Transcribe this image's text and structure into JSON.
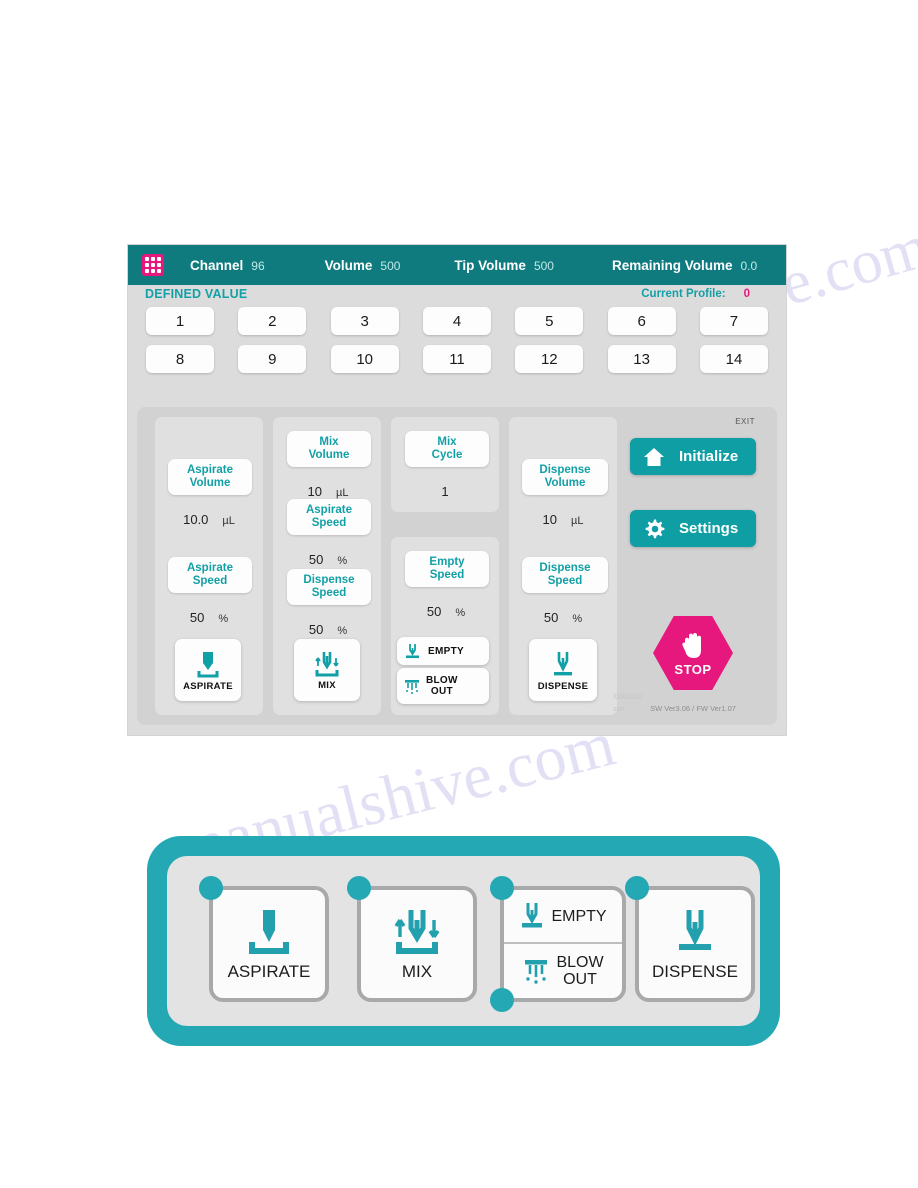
{
  "watermark": {
    "line_a": "manualshive.com",
    "line_b": "manualshive.com"
  },
  "device": {
    "header": {
      "grid_icon": "grid-icon",
      "stats": [
        {
          "label": "Channel",
          "value": "96"
        },
        {
          "label": "Volume",
          "value": "500"
        },
        {
          "label": "Tip Volume",
          "value": "500"
        },
        {
          "label": "Remaining Volume",
          "value": "0.0"
        }
      ]
    },
    "defined_value_label": "DEFINED VALUE",
    "current_profile": {
      "label": "Current Profile:",
      "value": "0"
    },
    "keypad": {
      "row1": [
        "1",
        "2",
        "3",
        "4",
        "5",
        "6",
        "7"
      ],
      "row2": [
        "8",
        "9",
        "10",
        "11",
        "12",
        "13",
        "14"
      ]
    },
    "columns": {
      "aspirate": {
        "volume_label": "Aspirate\nVolume",
        "volume_value": "10.0",
        "volume_unit": "µL",
        "speed_label": "Aspirate\nSpeed",
        "speed_value": "50",
        "speed_unit": "%",
        "action_label": "ASPIRATE",
        "action_icon": "aspirate-icon"
      },
      "mix": {
        "volume_label": "Mix\nVolume",
        "volume_value": "10",
        "volume_unit": "µL",
        "aspirate_speed_label": "Aspirate\nSpeed",
        "aspirate_speed_value": "50",
        "aspirate_speed_unit": "%",
        "dispense_speed_label": "Dispense\nSpeed",
        "dispense_speed_value": "50",
        "dispense_speed_unit": "%",
        "action_label": "MIX",
        "action_icon": "mix-icon"
      },
      "mix_cycle": {
        "label": "Mix\nCycle",
        "value": "1"
      },
      "empty": {
        "speed_label": "Empty\nSpeed",
        "speed_value": "50",
        "speed_unit": "%",
        "empty_label": "EMPTY",
        "empty_icon": "empty-icon",
        "blowout_label": "BLOW\nOUT",
        "blowout_icon": "blowout-icon"
      },
      "dispense": {
        "volume_label": "Dispense\nVolume",
        "volume_value": "10",
        "volume_unit": "µL",
        "speed_label": "Dispense\nSpeed",
        "speed_value": "50",
        "speed_unit": "%",
        "action_label": "DISPENSE",
        "action_icon": "dispense-icon"
      }
    },
    "right_panel": {
      "exit_label": "EXIT",
      "initialize_label": "Initialize",
      "initialize_icon": "home-icon",
      "settings_label": "Settings",
      "settings_icon": "gear-icon",
      "stop_label": "STOP",
      "stop_icon": "hand-icon",
      "firmware_line": "SW Ver3.06 / FW Ver1.07",
      "serial_line": "/0000000",
      "serial_line2": "stat"
    },
    "colors": {
      "header_teal": "#0f7b7f",
      "accent_teal": "#12a0a6",
      "button_teal": "#0f9ea4",
      "stop_magenta": "#e6187e",
      "panel_gray": "#d2d2d2",
      "screen_gray": "#dcdcdc"
    }
  },
  "legend": {
    "frame_color": "#23a8b4",
    "cards": [
      {
        "label": "ASPIRATE",
        "icon": "aspirate-icon"
      },
      {
        "label": "MIX",
        "icon": "mix-icon"
      },
      {
        "label_top": "EMPTY",
        "icon_top": "empty-icon",
        "label_bottom": "BLOW\nOUT",
        "icon_bottom": "blowout-icon"
      },
      {
        "label": "DISPENSE",
        "icon": "dispense-icon"
      }
    ]
  }
}
